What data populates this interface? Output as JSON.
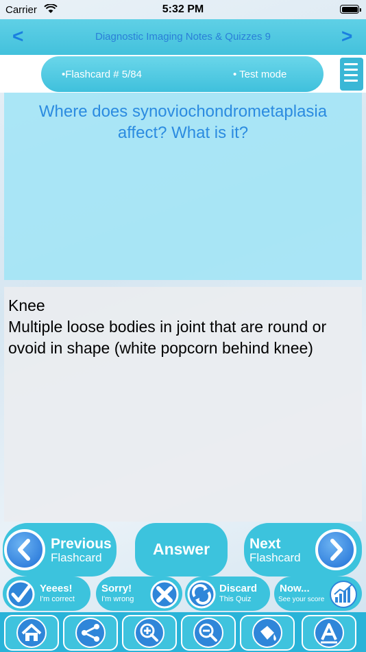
{
  "status_bar": {
    "carrier": "Carrier",
    "time": "5:32 PM"
  },
  "nav": {
    "title": "Diagnostic Imaging Notes & Quizzes 9",
    "back": "<",
    "forward": ">"
  },
  "flashcard_bar": {
    "counter": "•Flashcard #  5/84",
    "mode": "• Test mode"
  },
  "question": {
    "text": "Where does synoviochondrometaplasia affect? What is it?"
  },
  "answer": {
    "line1": "Knee",
    "line2": "Multiple loose bodies in joint that are round or ovoid in shape (white popcorn behind knee)"
  },
  "buttons": {
    "previous": {
      "title": "Previous",
      "sub": "Flashcard"
    },
    "answer": {
      "label": "Answer"
    },
    "next": {
      "title": "Next",
      "sub": "Flashcard"
    },
    "correct": {
      "title": "Yeees!",
      "sub": "I'm correct"
    },
    "wrong": {
      "title": "Sorry!",
      "sub": "I'm wrong"
    },
    "discard": {
      "title": "Discard",
      "sub": "This Quiz"
    },
    "score": {
      "title": "Now...",
      "sub": "See your score"
    }
  },
  "toolbar": [
    "home-icon",
    "share-icon",
    "zoom-in-icon",
    "zoom-out-icon",
    "paint-icon",
    "font-icon"
  ],
  "colors": {
    "accent": "#3cc3dd",
    "question_text": "#2b8be0",
    "nav_title": "#2a7fd8"
  }
}
